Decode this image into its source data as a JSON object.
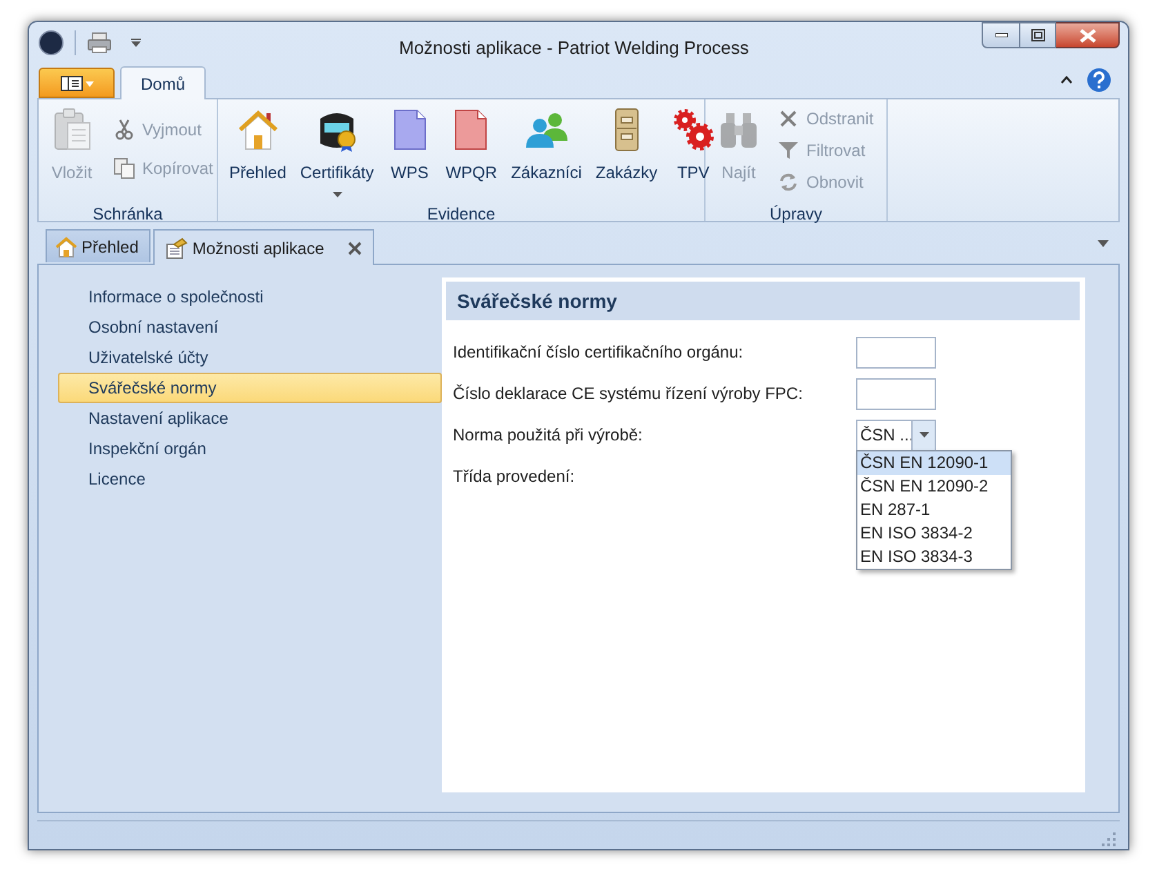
{
  "window": {
    "title": "Možnosti aplikace - Patriot Welding Process"
  },
  "ribbon": {
    "tabs": [
      {
        "label": "Domů",
        "selected": true
      }
    ],
    "groups": [
      {
        "label": "Schránka",
        "items": [
          {
            "label": "Vložit",
            "kind": "large",
            "disabled": true
          },
          {
            "label": "Vyjmout",
            "kind": "small",
            "disabled": true
          },
          {
            "label": "Kopírovat",
            "kind": "small",
            "disabled": true
          }
        ]
      },
      {
        "label": "Evidence",
        "items": [
          {
            "label": "Přehled",
            "kind": "large",
            "disabled": false
          },
          {
            "label": "Certifikáty",
            "kind": "large",
            "disabled": false,
            "dropdown": true
          },
          {
            "label": "WPS",
            "kind": "large",
            "disabled": false
          },
          {
            "label": "WPQR",
            "kind": "large",
            "disabled": false
          },
          {
            "label": "Zákazníci",
            "kind": "large",
            "disabled": false
          },
          {
            "label": "Zakázky",
            "kind": "large",
            "disabled": false
          },
          {
            "label": "TPV",
            "kind": "large",
            "disabled": false
          }
        ]
      },
      {
        "label": "Úpravy",
        "items": [
          {
            "label": "Najít",
            "kind": "large",
            "disabled": true
          },
          {
            "label": "Odstranit",
            "kind": "small",
            "disabled": true
          },
          {
            "label": "Filtrovat",
            "kind": "small",
            "disabled": true
          },
          {
            "label": "Obnovit",
            "kind": "small",
            "disabled": true
          }
        ]
      }
    ]
  },
  "document_tabs": [
    {
      "label": "Přehled",
      "selected": false
    },
    {
      "label": "Možnosti aplikace",
      "selected": true,
      "closable": true
    }
  ],
  "nav": {
    "items": [
      {
        "label": "Informace o společnosti",
        "selected": false
      },
      {
        "label": "Osobní nastavení",
        "selected": false
      },
      {
        "label": "Uživatelské účty",
        "selected": false
      },
      {
        "label": "Svářečské normy",
        "selected": true
      },
      {
        "label": "Nastavení aplikace",
        "selected": false
      },
      {
        "label": "Inspekční orgán",
        "selected": false
      },
      {
        "label": "Licence",
        "selected": false
      }
    ]
  },
  "panel": {
    "title": "Svářečské normy",
    "fields": [
      {
        "label": "Identifikační číslo certifikačního orgánu:",
        "kind": "text"
      },
      {
        "label": "Číslo deklarace CE systému řízení výroby FPC:",
        "kind": "text"
      },
      {
        "label": "Norma použitá při výrobě:",
        "kind": "combo",
        "value": "ČSN ...",
        "expanded": true,
        "options": [
          {
            "label": "ČSN EN 12090-1",
            "selected": true
          },
          {
            "label": "ČSN EN 12090-2",
            "selected": false
          },
          {
            "label": "EN 287-1",
            "selected": false
          },
          {
            "label": "EN ISO 3834-2",
            "selected": false
          },
          {
            "label": "EN ISO 3834-3",
            "selected": false
          }
        ]
      },
      {
        "label": "Třída provedení:",
        "kind": "label"
      }
    ]
  }
}
